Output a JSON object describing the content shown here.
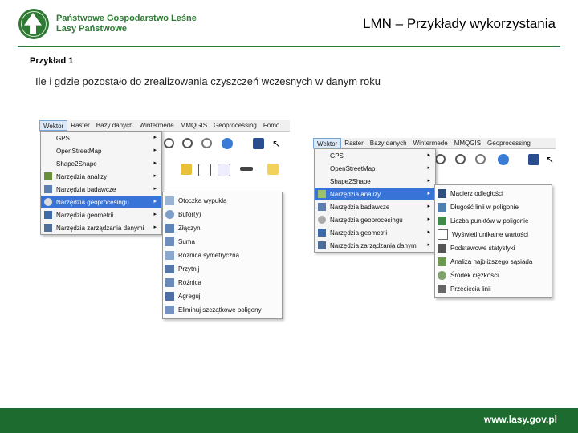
{
  "header": {
    "org_line1": "Państwowe Gospodarstwo Leśne",
    "org_line2": "Lasy Państwowe",
    "title": "LMN – Przykłady wykorzystania"
  },
  "subtitle": "Przykład 1",
  "description": "Ile i gdzie pozostało do zrealizowania czyszczeń wczesnych w danym roku",
  "menubar": [
    "Wektor",
    "Raster",
    "Bazy danych",
    "Wintermede",
    "MMQGIS",
    "Geoprocessing",
    "Fomo"
  ],
  "wektor_menu": [
    {
      "label": "GPS",
      "arrow": "▸"
    },
    {
      "label": "OpenStreetMap",
      "arrow": "▸"
    },
    {
      "label": "Shape2Shape",
      "arrow": "▸"
    },
    {
      "label": "Narzędzia analizy",
      "arrow": "▸"
    },
    {
      "label": "Narzędzia badawcze",
      "arrow": "▸"
    },
    {
      "label": "Narzędzia geoprocesingu",
      "arrow": "▸"
    },
    {
      "label": "Narzędzia geometrii",
      "arrow": "▸"
    },
    {
      "label": "Narzędzia zarządzania danymi",
      "arrow": "▸"
    }
  ],
  "geoprocessing_submenu": [
    "Otoczka wypukła",
    "Bufor(y)",
    "Złączyn",
    "Suma",
    "Różnica symetryczna",
    "Przytnij",
    "Różnica",
    "Agreguj",
    "Eliminuj szczątkowe poligony"
  ],
  "analysis_submenu": [
    "Macierz odległości",
    "Długość linii w poligonie",
    "Liczba punktów w poligonie",
    "Wyświetl unikalne wartości",
    "Podstawowe statystyki",
    "Analiza najbliższego sąsiada",
    "Środek ciężkości",
    "Przecięcia linii"
  ],
  "footer_url": "www.lasy.gov.pl",
  "colors": {
    "brand_green": "#2e7a35",
    "highlight_blue": "#3874d8",
    "footer_green": "#1d6b2e"
  }
}
